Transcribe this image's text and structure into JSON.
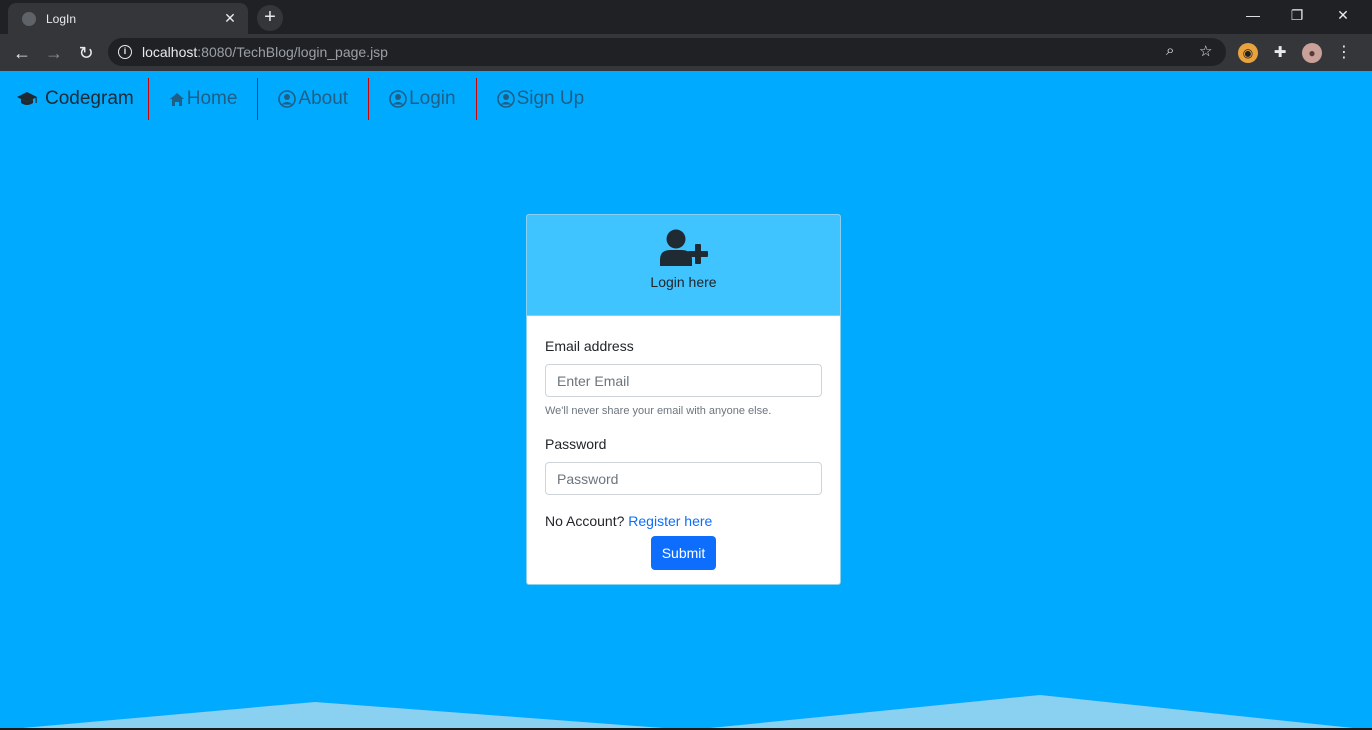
{
  "browser": {
    "tab_title": "LogIn",
    "url_host": "localhost",
    "url_rest": ":8080/TechBlog/login_page.jsp"
  },
  "navbar": {
    "brand": "Codegram",
    "links": [
      {
        "label": "Home",
        "icon": "home-icon"
      },
      {
        "label": "About",
        "icon": "user-circle-icon"
      },
      {
        "label": "Login",
        "icon": "user-circle-icon"
      },
      {
        "label": "Sign Up",
        "icon": "user-circle-icon"
      }
    ]
  },
  "login_card": {
    "header_title": "Login here",
    "email_label": "Email address",
    "email_placeholder": "Enter Email",
    "email_help": "We'll never share your email with anyone else.",
    "password_label": "Password",
    "password_placeholder": "Password",
    "no_account_text": "No Account?",
    "register_link": "Register here",
    "submit_label": "Submit"
  },
  "colors": {
    "page_background": "#00aaff",
    "card_header": "#40c4ff",
    "primary": "#0d6efd",
    "nav_divider": "#d40000"
  }
}
